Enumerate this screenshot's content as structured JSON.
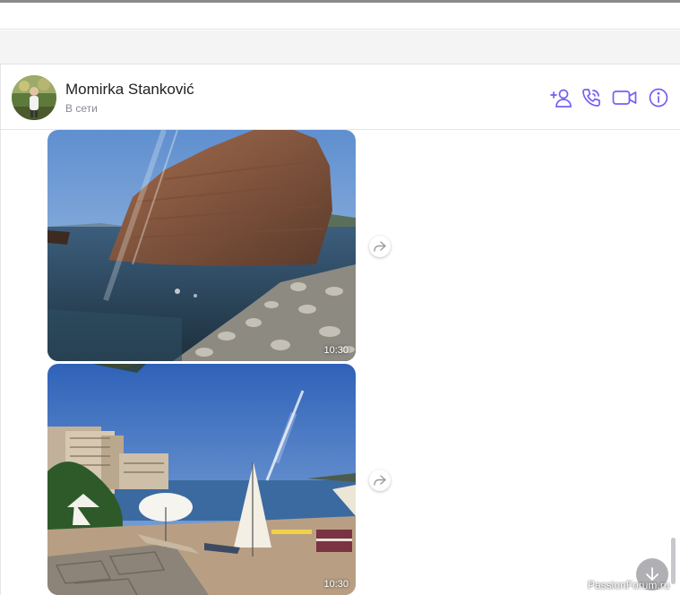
{
  "header": {
    "contact_name": "Momirka Stanković",
    "status": "В сети",
    "icons": [
      "add-contact-icon",
      "phone-icon",
      "video-call-icon",
      "info-icon"
    ],
    "accent_color": "#7360f2"
  },
  "messages": [
    {
      "type": "photo",
      "subject": "rock in sea",
      "time": "10:30"
    },
    {
      "type": "photo",
      "subject": "beach with umbrellas",
      "time": "10:30"
    }
  ],
  "watermark": "PassionForum.ru"
}
